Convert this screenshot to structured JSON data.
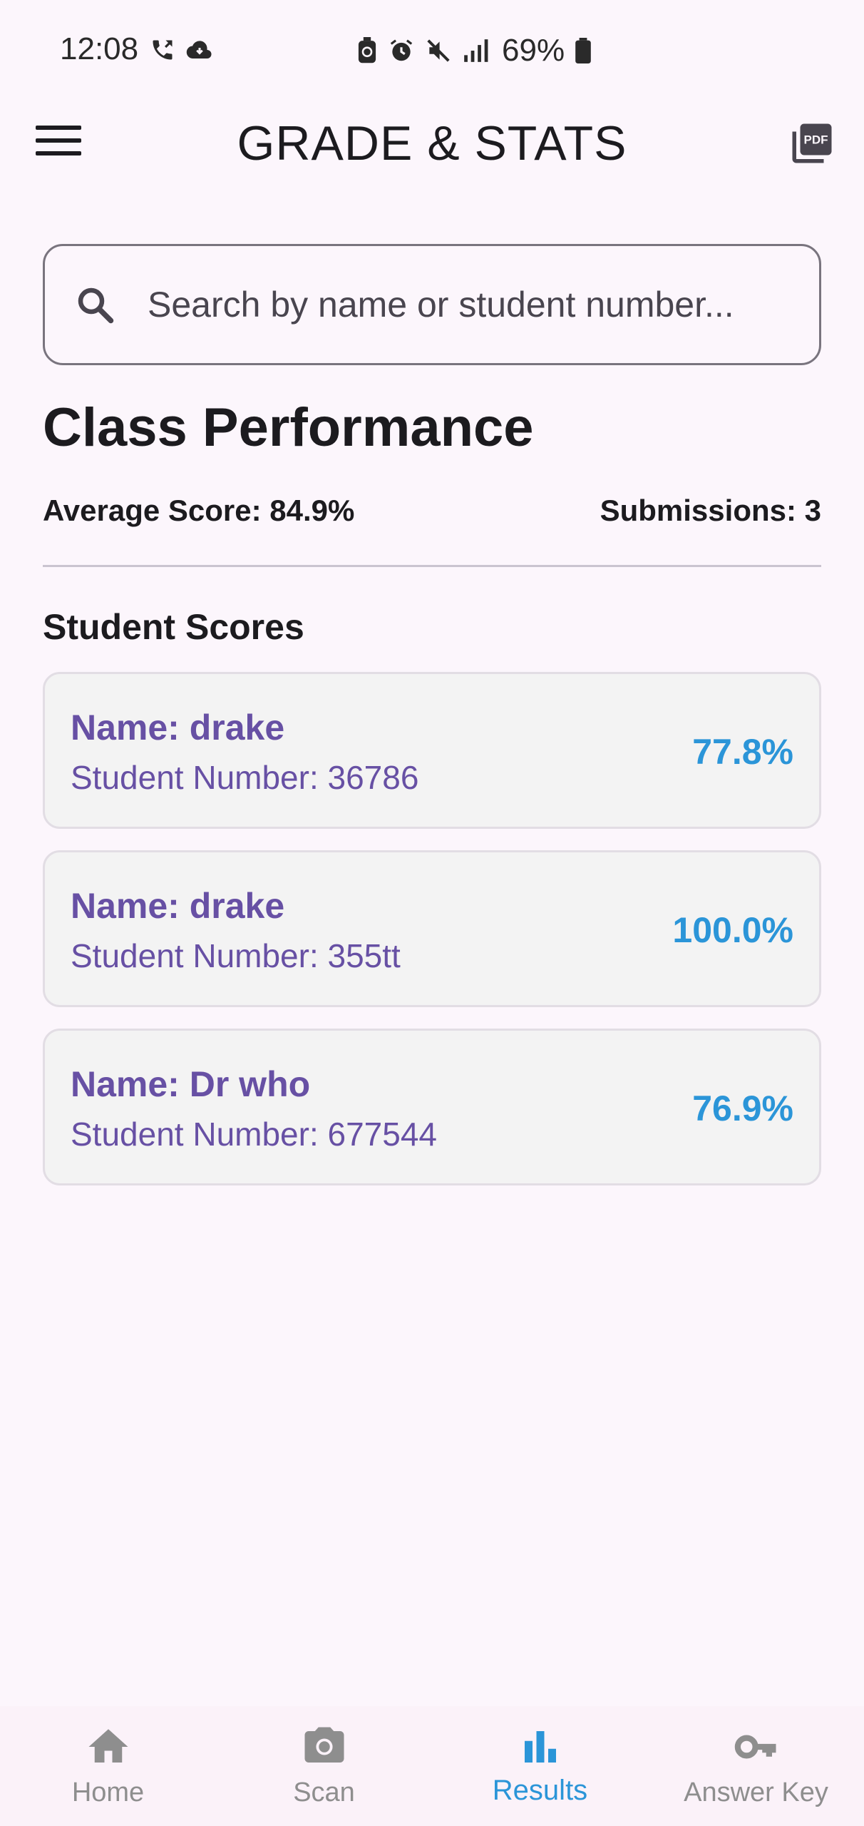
{
  "status_bar": {
    "time": "12:08",
    "battery": "69%"
  },
  "app_bar": {
    "title": "GRADE & STATS",
    "menu_icon": "hamburger-menu-icon",
    "action_icon": "pdf-icon"
  },
  "search": {
    "placeholder": "Search by name or student number...",
    "value": ""
  },
  "performance": {
    "title": "Class Performance",
    "average_label": "Average Score: 84.9%",
    "submissions_label": "Submissions: 3"
  },
  "scores": {
    "title": "Student Scores",
    "students": [
      {
        "name": "Name: drake",
        "number": "Student Number: 36786",
        "score": "77.8%"
      },
      {
        "name": "Name: drake",
        "number": "Student Number: 355tt",
        "score": "100.0%"
      },
      {
        "name": "Name: Dr who",
        "number": "Student Number: 677544",
        "score": "76.9%"
      }
    ]
  },
  "bottom_nav": {
    "items": [
      {
        "label": "Home",
        "icon": "home-icon"
      },
      {
        "label": "Scan",
        "icon": "camera-icon"
      },
      {
        "label": "Results",
        "icon": "bar-chart-icon"
      },
      {
        "label": "Answer Key",
        "icon": "key-icon"
      }
    ],
    "active": "Results"
  },
  "colors": {
    "background": "#fcf6fc",
    "accent_purple": "#6750a4",
    "accent_blue": "#2b95d8",
    "card": "#f3f3f3"
  }
}
